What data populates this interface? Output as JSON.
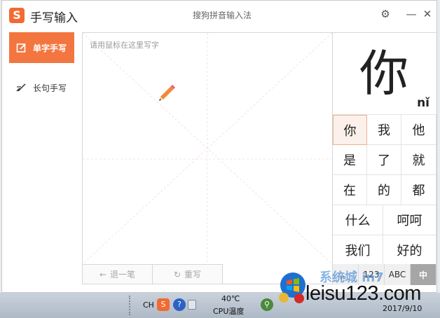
{
  "window": {
    "app_title": "手写输入",
    "sub_title": "搜狗拼音输入法",
    "settings_glyph": "⚙",
    "minimize_glyph": "—",
    "close_glyph": "✕"
  },
  "nav": {
    "items": [
      {
        "label": "单字手写",
        "active": true
      },
      {
        "label": "长句手写",
        "active": false
      }
    ]
  },
  "pad": {
    "hint": "请用鼠标在这里写字",
    "undo_label": "退一笔",
    "rewrite_label": "重写"
  },
  "preview": {
    "char": "你",
    "pinyin": "nǐ"
  },
  "candidates": {
    "row1": [
      "你",
      "我",
      "他"
    ],
    "row2": [
      "是",
      "了",
      "就"
    ],
    "row3": [
      "在",
      "的",
      "都"
    ],
    "row4": [
      "什么",
      "呵呵"
    ],
    "row5": [
      "我们",
      "好的"
    ]
  },
  "modes": [
    {
      "label": ",。",
      "active": false
    },
    {
      "label": "123",
      "active": false
    },
    {
      "label": "ABC",
      "active": false
    },
    {
      "label": "中",
      "active": true
    }
  ],
  "taskbar": {
    "lang": "CH",
    "temperature": "40℃",
    "cpu_label": "CPU温度",
    "date": "2017/9/10"
  },
  "watermark": {
    "text": "leisu123.com",
    "sub": "系统城 in7"
  },
  "colors": {
    "accent": "#f37640",
    "selected_bg": "#fbf1ea",
    "mode_active": "#a6a6a6"
  }
}
